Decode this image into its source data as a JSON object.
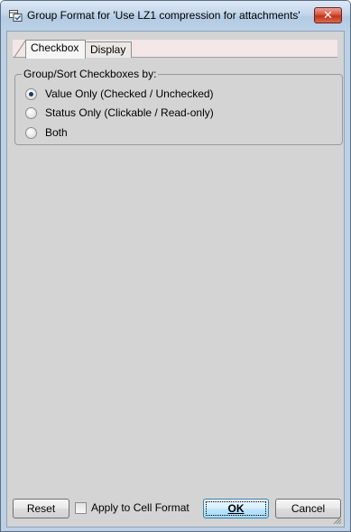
{
  "window": {
    "title": "Group Format for 'Use LZ1 compression for attachments'",
    "close_glyph": "✕",
    "title_icon": "group-format-icon"
  },
  "tabs": [
    {
      "label": "Checkbox",
      "active": true
    },
    {
      "label": "Display",
      "active": false
    }
  ],
  "group": {
    "label": "Group/Sort Checkboxes by:",
    "options": [
      {
        "label": "Value Only (Checked / Unchecked)",
        "selected": true
      },
      {
        "label": "Status Only (Clickable / Read-only)",
        "selected": false
      },
      {
        "label": "Both",
        "selected": false
      }
    ]
  },
  "footer": {
    "reset_label": "Reset",
    "apply_label": "Apply to Cell Format",
    "apply_checked": false,
    "ok_label": "OK",
    "cancel_label": "Cancel"
  },
  "colors": {
    "frame": "#bdd0e4",
    "client": "#d4d4d4",
    "close": "#c13419",
    "ok_border": "#3c7fb1"
  }
}
